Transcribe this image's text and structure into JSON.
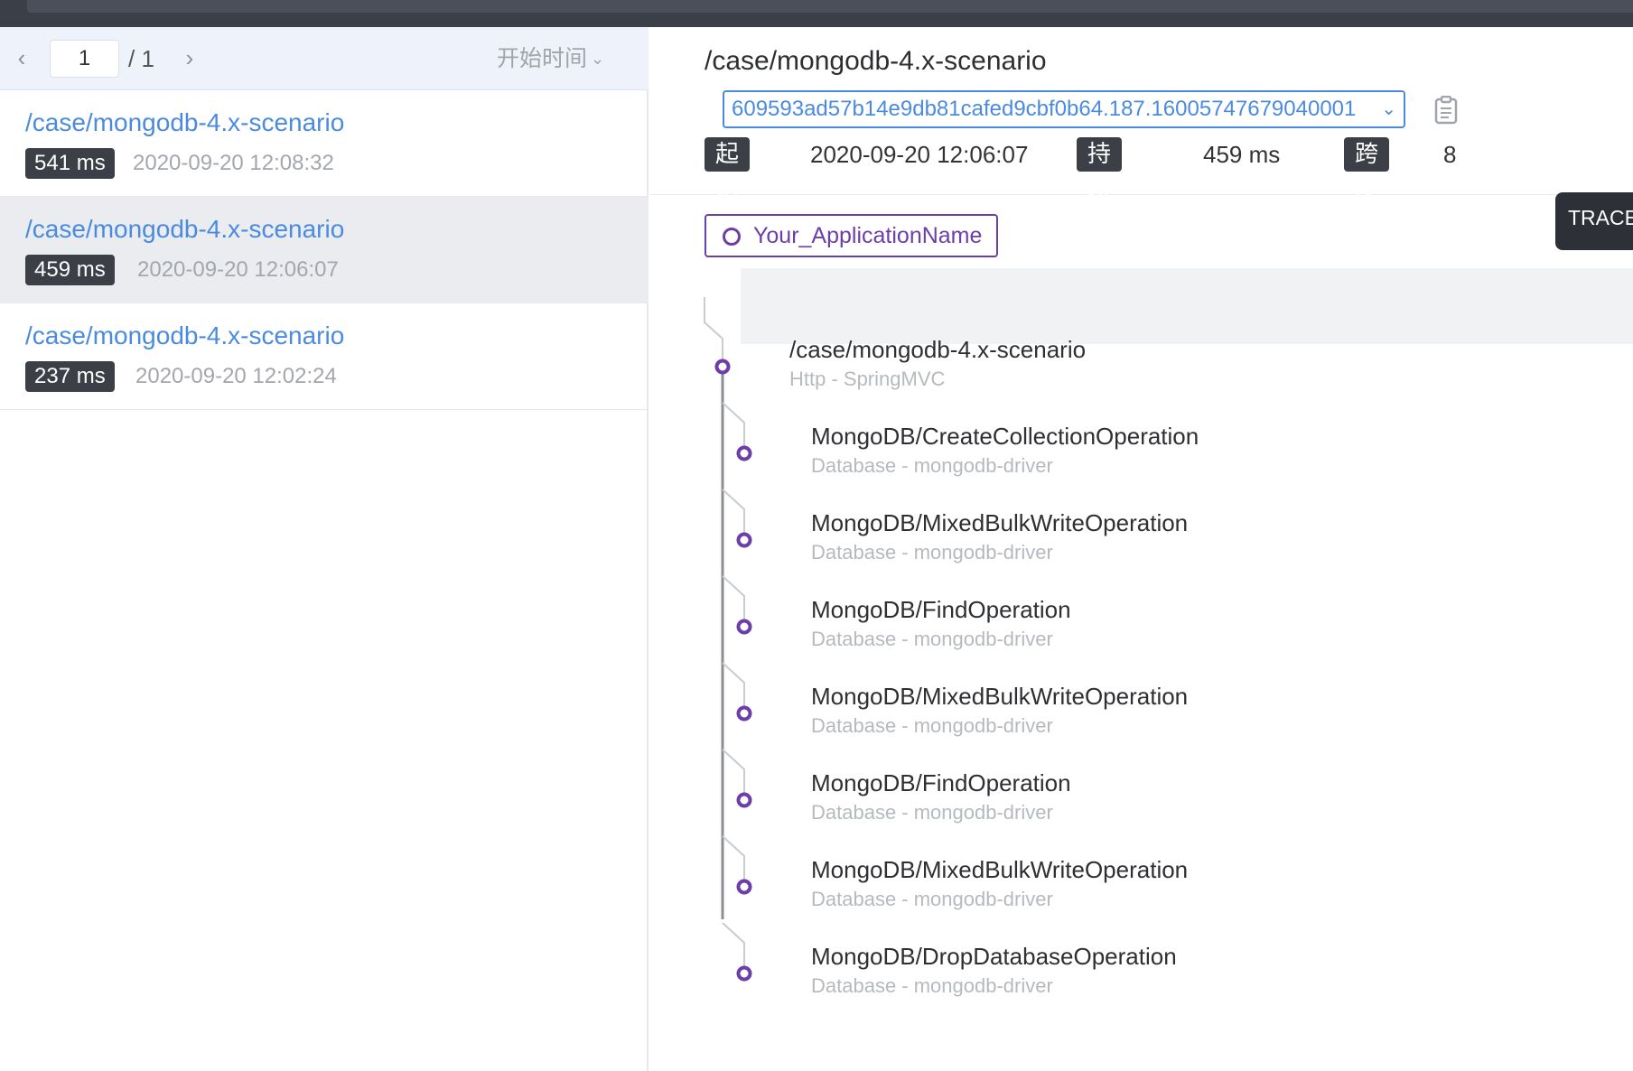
{
  "pager": {
    "current_page": "1",
    "total": "/ 1",
    "sort_label": "开始时间"
  },
  "trace_list": [
    {
      "endpoint": "/case/mongodb-4.x-scenario",
      "duration": "541 ms",
      "time": "2020-09-20 12:08:32",
      "selected": false
    },
    {
      "endpoint": "/case/mongodb-4.x-scenario",
      "duration": "459 ms",
      "time": "2020-09-20 12:06:07",
      "selected": true
    },
    {
      "endpoint": "/case/mongodb-4.x-scenario",
      "duration": "237 ms",
      "time": "2020-09-20 12:02:24",
      "selected": false
    }
  ],
  "detail": {
    "title": "/case/mongodb-4.x-scenario",
    "trace_id": "609593ad57b14e9db81cafed9cbf0b64.187.16005747679040001",
    "start_label": "起始点",
    "start_value": "2020-09-20 12:06:07",
    "duration_label": "持续时间",
    "duration_value": "459 ms",
    "span_label": "跨度",
    "span_value": "8",
    "app_name": "Your_ApplicationName",
    "trace_button": "TRACE"
  },
  "spans": [
    {
      "name": "/case/mongodb-4.x-scenario",
      "type": "Http - SpringMVC",
      "depth": 0
    },
    {
      "name": "MongoDB/CreateCollectionOperation",
      "type": "Database - mongodb-driver",
      "depth": 1
    },
    {
      "name": "MongoDB/MixedBulkWriteOperation",
      "type": "Database - mongodb-driver",
      "depth": 1
    },
    {
      "name": "MongoDB/FindOperation",
      "type": "Database - mongodb-driver",
      "depth": 1
    },
    {
      "name": "MongoDB/MixedBulkWriteOperation",
      "type": "Database - mongodb-driver",
      "depth": 1
    },
    {
      "name": "MongoDB/FindOperation",
      "type": "Database - mongodb-driver",
      "depth": 1
    },
    {
      "name": "MongoDB/MixedBulkWriteOperation",
      "type": "Database - mongodb-driver",
      "depth": 1
    },
    {
      "name": "MongoDB/DropDatabaseOperation",
      "type": "Database - mongodb-driver",
      "depth": 1
    }
  ],
  "colors": {
    "accent_blue": "#4a8be0",
    "accent_purple": "#6c3fa8",
    "badge_dark": "#3c4046"
  },
  "icons": {
    "prev": "chevron-left-icon",
    "next": "chevron-right-icon",
    "sort": "chevron-down-icon",
    "copy": "clipboard-icon",
    "app": "ring-icon"
  }
}
